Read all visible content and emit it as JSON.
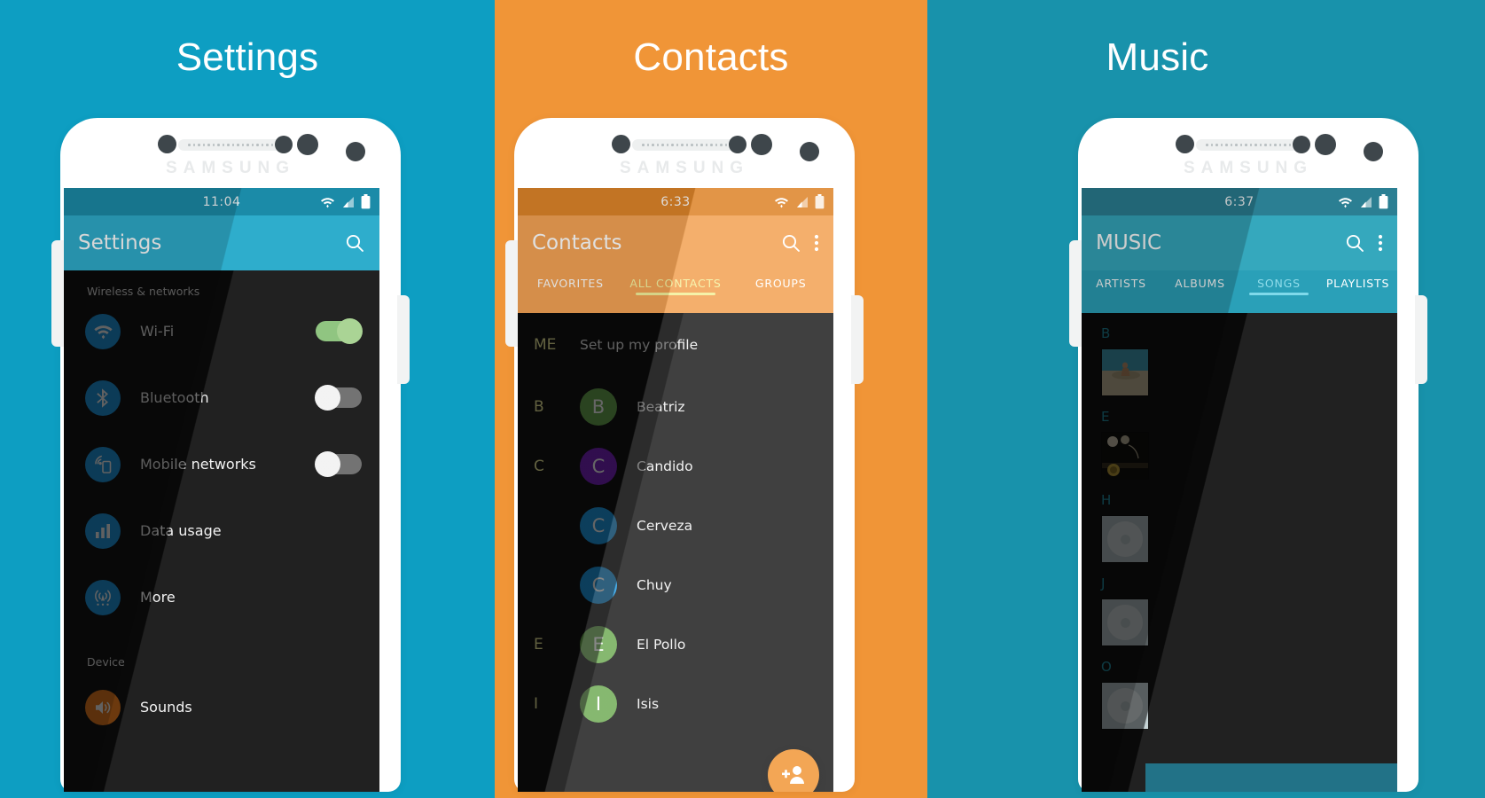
{
  "panels": [
    {
      "title": "Settings",
      "bg": "#0d9ec2",
      "statusbar": {
        "time": "11:04",
        "wifi": "wifi-icon",
        "signal": "signal-icon",
        "battery": "battery-icon"
      },
      "appbar": {
        "title": "Settings",
        "search": "search-icon"
      },
      "sections": [
        {
          "label": "Wireless & networks",
          "items": [
            {
              "label": "Wi-Fi",
              "icon": "wifi-icon",
              "icon_color": "#1e9be6",
              "toggle": "on"
            },
            {
              "label": "Bluetooth",
              "icon": "bluetooth-icon",
              "icon_color": "#1e9be6",
              "toggle": "off"
            },
            {
              "label": "Mobile networks",
              "icon": "mobile-network-icon",
              "icon_color": "#1e9be6",
              "toggle": "off"
            },
            {
              "label": "Data usage",
              "icon": "bar-chart-icon",
              "icon_color": "#1e9be6",
              "toggle": "none"
            },
            {
              "label": "More",
              "icon": "broadcast-icon",
              "icon_color": "#1e9be6",
              "toggle": "none"
            }
          ]
        },
        {
          "label": "Device",
          "items": [
            {
              "label": "Sounds",
              "icon": "volume-icon",
              "icon_color": "#ef7f1f",
              "toggle": "none"
            }
          ]
        }
      ]
    },
    {
      "title": "Contacts",
      "bg": "#f09537",
      "statusbar": {
        "time": "6:33",
        "wifi": "wifi-icon",
        "signal": "signal-icon",
        "battery": "battery-icon"
      },
      "appbar": {
        "title": "Contacts",
        "search": "search-icon",
        "overflow": "more-vert-icon"
      },
      "tabs": [
        {
          "label": "FAVORITES",
          "active": false
        },
        {
          "label": "ALL CONTACTS",
          "active": true
        },
        {
          "label": "GROUPS",
          "active": false
        }
      ],
      "me": {
        "index": "ME",
        "label": "Set up my profile"
      },
      "contacts": [
        {
          "index": "B",
          "initial": "B",
          "name": "Beatriz",
          "color": "#6aa84f"
        },
        {
          "index": "C",
          "initial": "C",
          "name": "Candido",
          "color": "#7b24c4"
        },
        {
          "index": "",
          "initial": "C",
          "name": "Cerveza",
          "color": "#1e9be6"
        },
        {
          "index": "",
          "initial": "C",
          "name": "Chuy",
          "color": "#1e9be6"
        },
        {
          "index": "E",
          "initial": "E",
          "name": "El Pollo",
          "color": "#6aa84f"
        },
        {
          "index": "I",
          "initial": "I",
          "name": "Isis",
          "color": "#6aa84f"
        }
      ],
      "fab": "add-contact-icon"
    },
    {
      "title": "Music",
      "bg": "#1892ab",
      "statusbar": {
        "time": "6:37",
        "wifi": "wifi-icon",
        "signal": "signal-icon",
        "battery": "battery-icon"
      },
      "appbar": {
        "title": "MUSIC",
        "search": "search-icon",
        "overflow": "more-vert-icon"
      },
      "tabs": [
        {
          "label": "ARTISTS",
          "active": false
        },
        {
          "label": "ALBUMS",
          "active": false
        },
        {
          "label": "SONGS",
          "active": true
        },
        {
          "label": "PLAYLISTS",
          "active": false
        }
      ],
      "groups": [
        {
          "letter": "B",
          "art": "photo-beach"
        },
        {
          "letter": "E",
          "art": "photo-stage"
        },
        {
          "letter": "H",
          "art": "disc-placeholder"
        },
        {
          "letter": "J",
          "art": "disc-placeholder"
        },
        {
          "letter": "O",
          "art": "disc-placeholder"
        }
      ],
      "now_playing_bar": true
    }
  ],
  "colors": {
    "settings_bg": "#0d9ec2",
    "settings_appbar": "#2eadcc",
    "contacts_bg": "#f09537",
    "contacts_appbar": "#f2a254",
    "music_bg": "#1892ab",
    "music_appbar": "#35a8bd",
    "list_bg": "#141414",
    "accent_green": "#8ac27a",
    "accent_orange": "#f0912e"
  },
  "device": {
    "brand": "SAMSUNG"
  }
}
